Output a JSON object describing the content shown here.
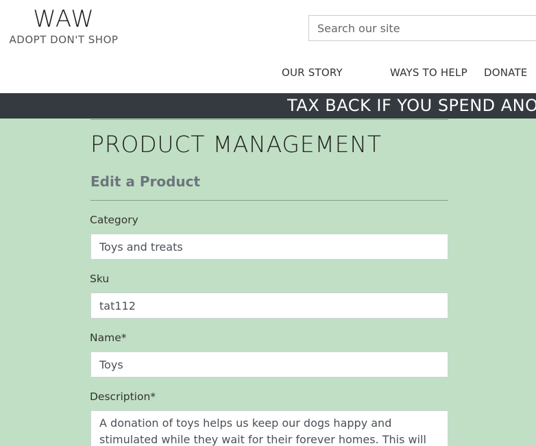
{
  "header": {
    "logo_title": "WAW",
    "logo_tagline": "ADOPT DON'T SHOP",
    "search_placeholder": "Search our site"
  },
  "nav": {
    "our_story": "OUR STORY",
    "ways_to_help": "WAYS TO HELP",
    "donate": "DONATE"
  },
  "banner": {
    "text": "TAX BACK IF YOU SPEND ANOT"
  },
  "main": {
    "page_title": "PRODUCT MANAGEMENT",
    "subtitle": "Edit a Product",
    "form": {
      "category_label": "Category",
      "category_value": "Toys and treats",
      "sku_label": "Sku",
      "sku_value": "tat112",
      "name_label": "Name*",
      "name_value": "Toys",
      "description_label": "Description*",
      "description_value": "A donation of toys helps us keep our dogs happy and stimulated while they wait for their forever homes. This will buy"
    }
  },
  "colors": {
    "banner_bg": "#343a40",
    "main_bg": "#c1dfc4"
  }
}
